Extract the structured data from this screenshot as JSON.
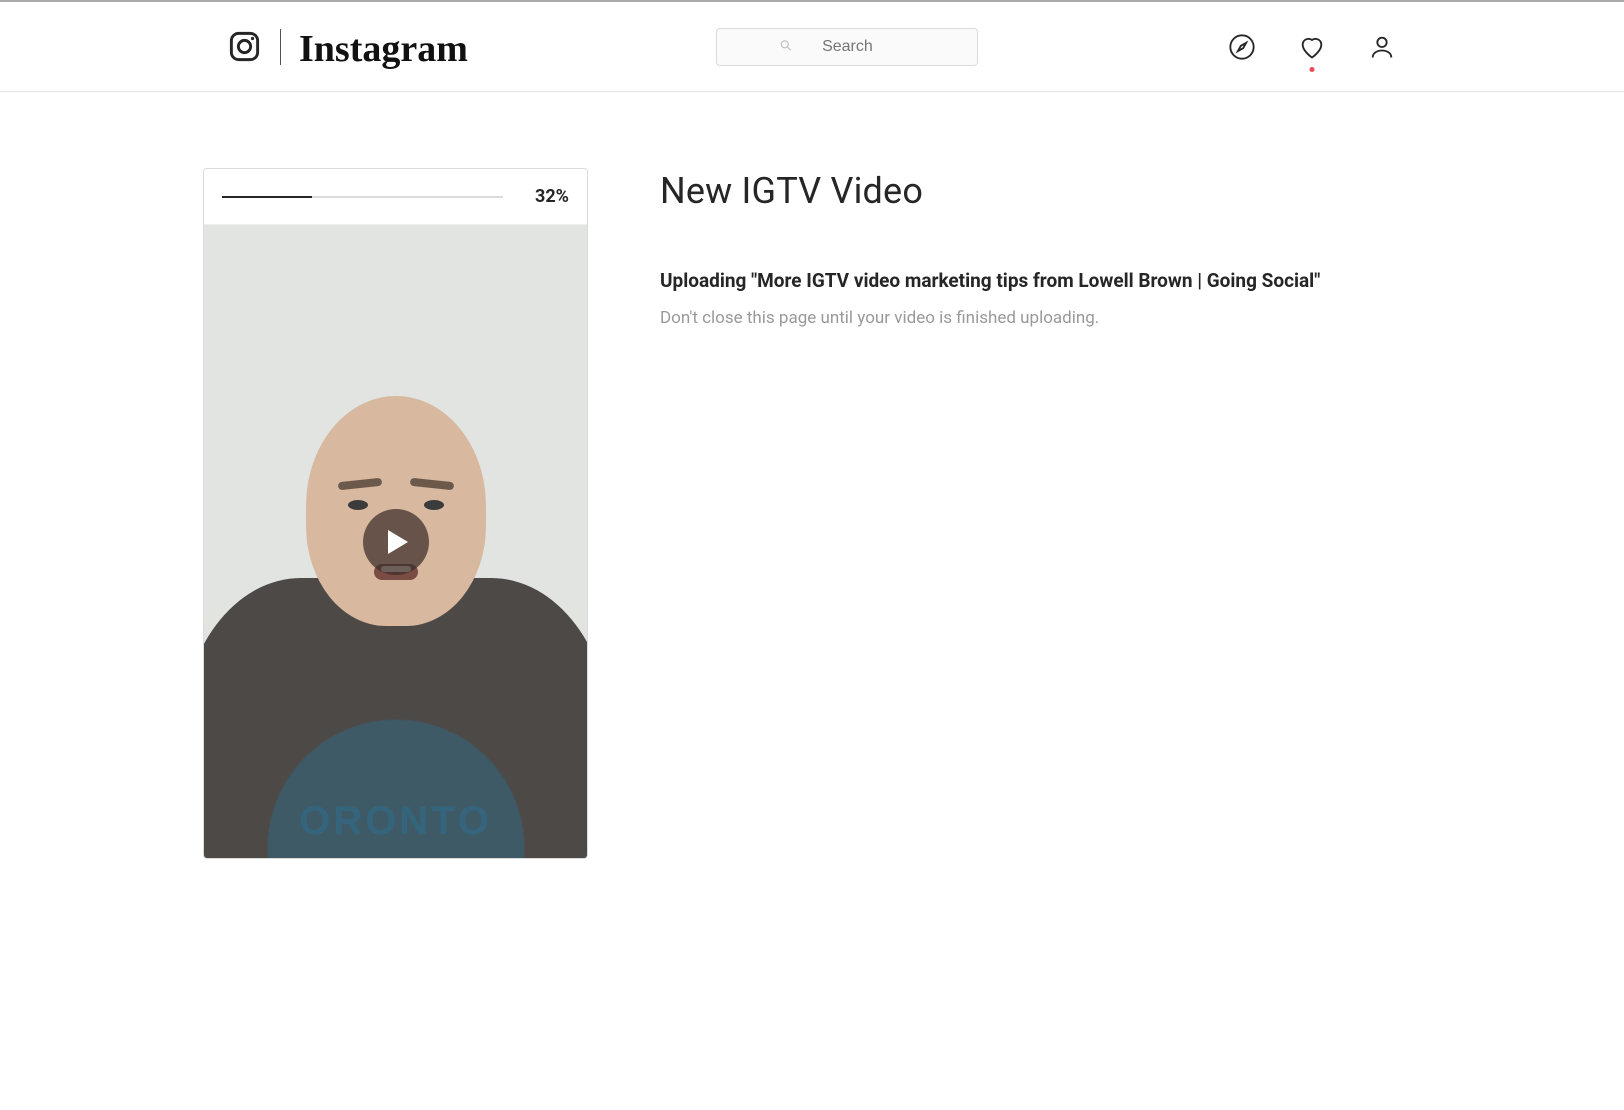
{
  "header": {
    "brand_word": "Instagram",
    "search_placeholder": "Search",
    "has_notification_dot": true
  },
  "upload": {
    "progress_percent": 32,
    "progress_label": "32%",
    "thumbnail_shirt_text": "ORONTO"
  },
  "details": {
    "page_title": "New IGTV Video",
    "status_line": "Uploading \"More IGTV video marketing tips from Lowell Brown | Going Social\"",
    "note_line": "Don't close this page until your video is finished uploading."
  }
}
